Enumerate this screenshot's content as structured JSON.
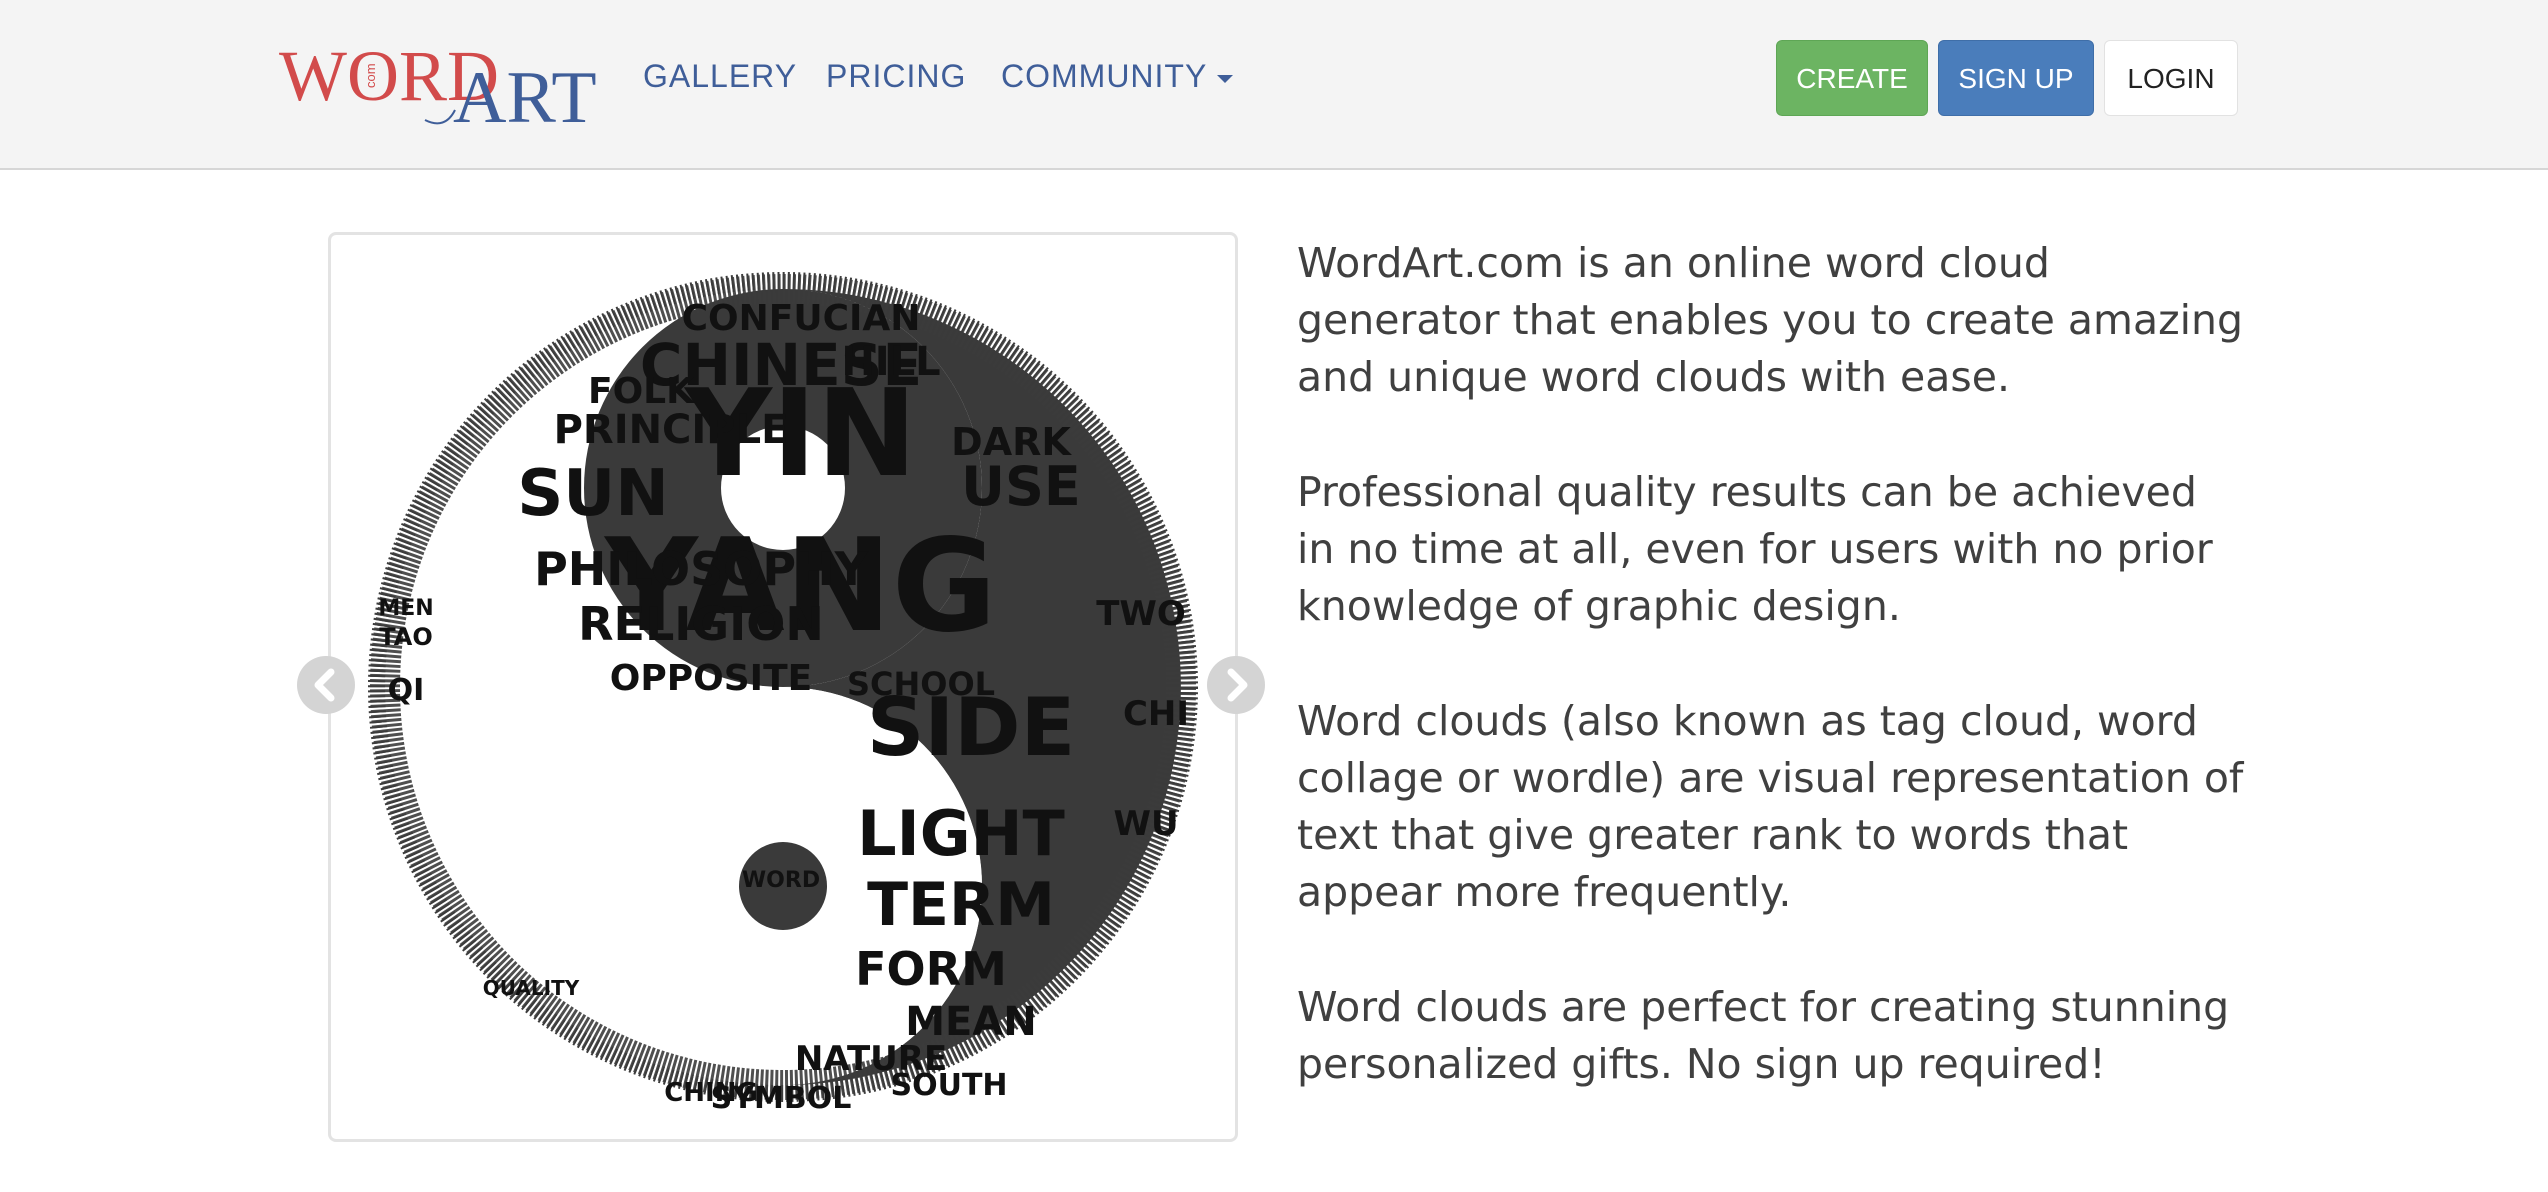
{
  "header": {
    "logo": {
      "word": "WORD",
      "com": "com",
      "art": "ART"
    },
    "nav": [
      {
        "label": "GALLERY"
      },
      {
        "label": "PRICING"
      },
      {
        "label": "COMMUNITY"
      }
    ],
    "buttons": {
      "create": "CREATE",
      "signup": "SIGN UP",
      "login": "LOGIN"
    }
  },
  "carousel": {
    "image_alt": "Yin Yang word cloud",
    "words": [
      "YIN",
      "YANG",
      "SIDE",
      "CHINESE",
      "SUN",
      "PHILOSOPHY",
      "RELIGION",
      "LIGHT",
      "TERM",
      "FORM",
      "PRINCIPLE",
      "CONFUCIAN",
      "DARK",
      "USE",
      "OPPOSITE",
      "MEAN",
      "SCHOOL",
      "WORD",
      "SYMBOL",
      "NATURE",
      "FOLK",
      "HILL",
      "CHI",
      "WU",
      "TWO",
      "QI",
      "TAO",
      "MEN",
      "QUALITY",
      "SOUTH",
      "CHING"
    ]
  },
  "description": [
    "WordArt.com is an online word cloud generator that enables you to create amazing and unique word clouds with ease.",
    "Professional quality results can be achieved in no time at all, even for users with no prior knowledge of graphic design.",
    "Word clouds (also known as tag cloud, word collage or wordle) are visual representation of text that give greater rank to words that appear more frequently.",
    "Word clouds are perfect for creating stunning personalized gifts. No sign up required!"
  ],
  "colors": {
    "logo_red": "#d24b4b",
    "logo_blue": "#3f5e99",
    "nav_link": "#3f5e99",
    "create_green": "#6cb462",
    "signup_blue": "#4a7dbb"
  },
  "icons": {
    "prev": "chevron-left-icon",
    "next": "chevron-right-icon",
    "dropdown": "caret-down-icon"
  }
}
